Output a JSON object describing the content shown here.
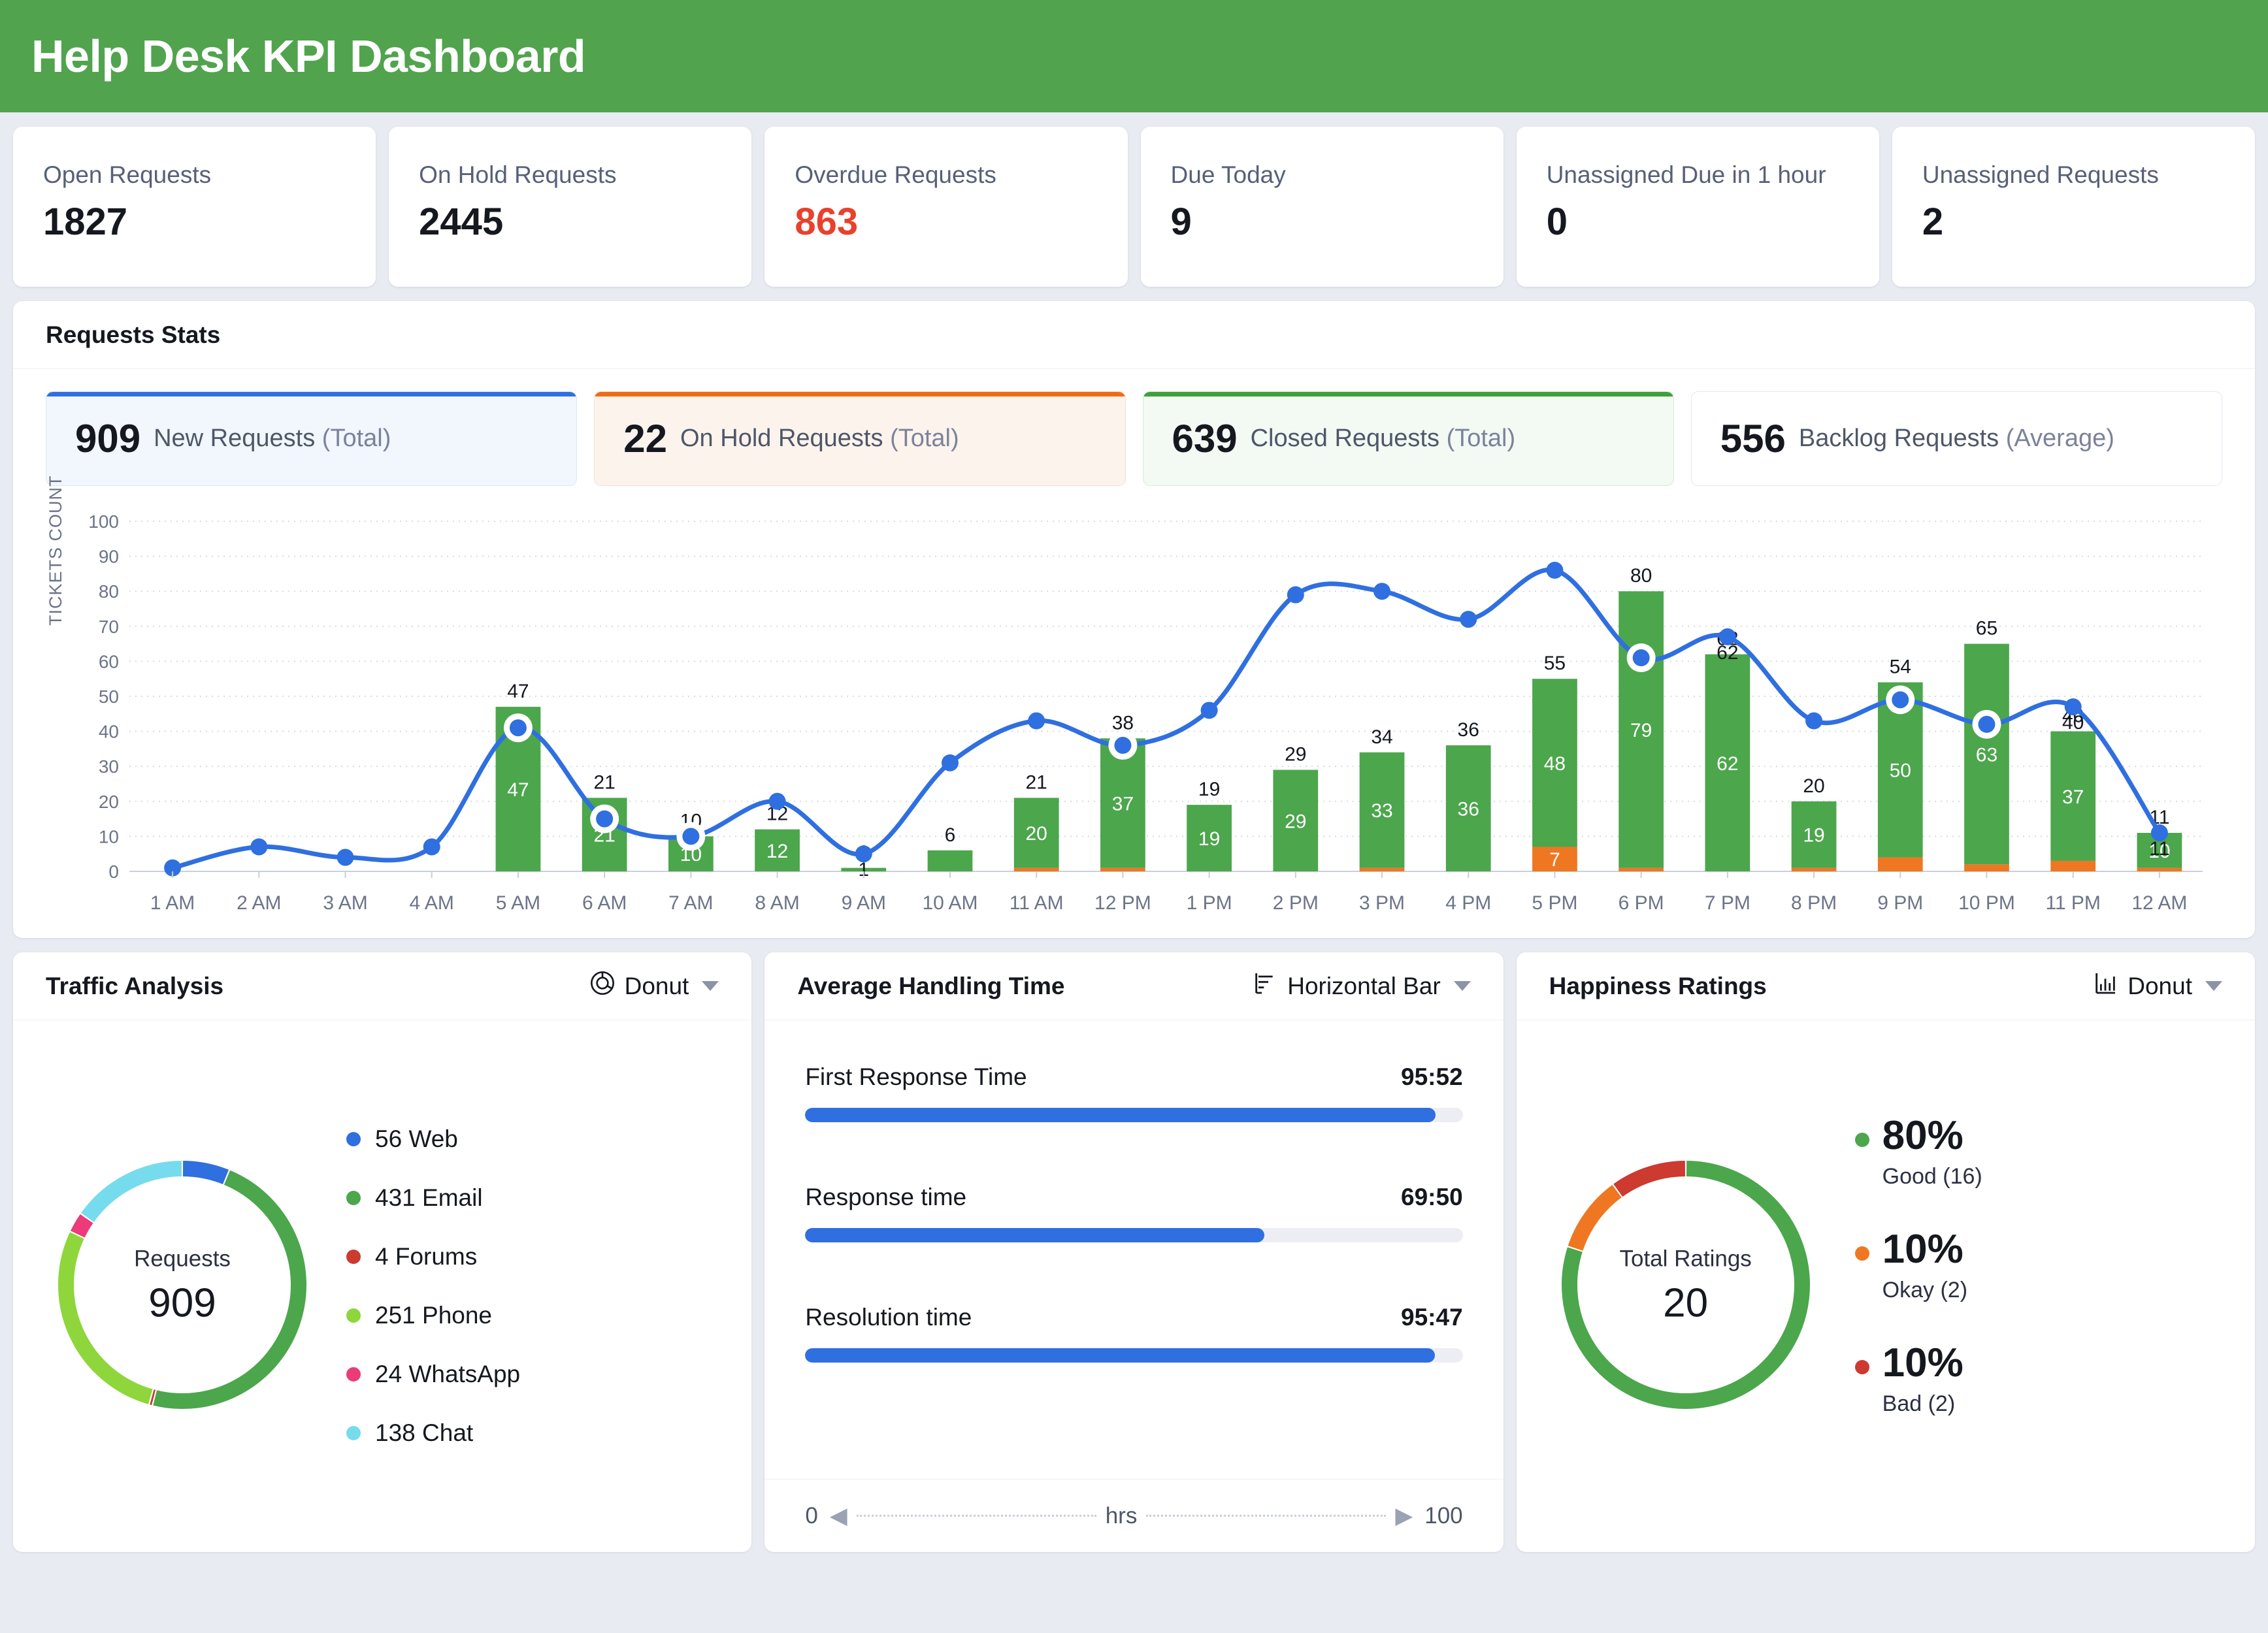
{
  "header": {
    "title": "Help Desk KPI Dashboard",
    "bg_color": "#51a34e"
  },
  "kpis": [
    {
      "label": "Open Requests",
      "value": "1827",
      "danger": false
    },
    {
      "label": "On Hold Requests",
      "value": "2445",
      "danger": false
    },
    {
      "label": "Overdue Requests",
      "value": "863",
      "danger": true
    },
    {
      "label": "Due Today",
      "value": "9",
      "danger": false
    },
    {
      "label": "Unassigned Due in 1 hour",
      "value": "0",
      "danger": false
    },
    {
      "label": "Unassigned Requests",
      "value": "2",
      "danger": false
    }
  ],
  "requests_stats": {
    "title": "Requests Stats",
    "pills": [
      {
        "value": "909",
        "label": "New Requests",
        "qualifier": "(Total)",
        "accent": "#2f6fe0"
      },
      {
        "value": "22",
        "label": "On Hold Requests",
        "qualifier": "(Total)",
        "accent": "#ef6c14"
      },
      {
        "value": "639",
        "label": "Closed Requests",
        "qualifier": "(Total)",
        "accent": "#3ea03a"
      },
      {
        "value": "556",
        "label": "Backlog Requests",
        "qualifier": "(Average)",
        "accent": "#ffffff"
      }
    ]
  },
  "chart_data": {
    "type": "bar",
    "title": "Requests Stats",
    "xlabel": "",
    "ylabel": "TICKETS COUNT",
    "ylim": [
      0,
      100
    ],
    "yticks": [
      0,
      10,
      20,
      30,
      40,
      50,
      60,
      70,
      80,
      90,
      100
    ],
    "grid": true,
    "legend": "none",
    "categories": [
      "1 AM",
      "2 AM",
      "3 AM",
      "4 AM",
      "5 AM",
      "6 AM",
      "7 AM",
      "8 AM",
      "9 AM",
      "10 AM",
      "11 AM",
      "12 PM",
      "1 PM",
      "2 PM",
      "3 PM",
      "4 PM",
      "5 PM",
      "6 PM",
      "7 PM",
      "8 PM",
      "9 PM",
      "10 PM",
      "11 PM",
      "12 AM"
    ],
    "series": [
      {
        "name": "Closed Requests",
        "type": "bar",
        "color": "#4ca64c",
        "values": [
          0,
          0,
          0,
          0,
          47,
          21,
          10,
          12,
          1,
          6,
          20,
          37,
          19,
          29,
          33,
          36,
          48,
          79,
          62,
          19,
          50,
          63,
          37,
          10
        ]
      },
      {
        "name": "On Hold Requests",
        "type": "bar",
        "color": "#ef7722",
        "values": [
          0,
          0,
          0,
          0,
          0,
          0,
          0,
          0,
          0,
          0,
          1,
          1,
          0,
          0,
          1,
          0,
          7,
          1,
          0,
          1,
          4,
          2,
          3,
          1
        ]
      },
      {
        "name": "New Requests",
        "type": "line",
        "color": "#2f6fe0",
        "values": [
          1,
          7,
          4,
          7,
          41,
          15,
          10,
          20,
          5,
          31,
          43,
          36,
          46,
          79,
          80,
          72,
          86,
          61,
          67,
          43,
          49,
          42,
          47,
          11
        ]
      }
    ],
    "bar_total_labels": [
      null,
      null,
      null,
      null,
      47,
      21,
      10,
      12,
      1,
      6,
      21,
      38,
      19,
      29,
      34,
      36,
      55,
      80,
      62,
      20,
      54,
      65,
      40,
      11
    ],
    "bar_inner_labels": [
      null,
      null,
      null,
      null,
      47,
      21,
      10,
      12,
      null,
      null,
      20,
      37,
      19,
      29,
      33,
      36,
      48,
      79,
      62,
      19,
      50,
      63,
      37,
      10
    ],
    "orange_inner_labels": [
      null,
      null,
      null,
      null,
      null,
      null,
      null,
      null,
      null,
      null,
      null,
      null,
      null,
      null,
      null,
      null,
      7,
      null,
      null,
      null,
      null,
      null,
      null,
      null
    ],
    "line_point_labels": [
      null,
      null,
      null,
      null,
      null,
      null,
      null,
      null,
      1,
      null,
      null,
      null,
      null,
      null,
      null,
      null,
      null,
      null,
      62,
      null,
      null,
      null,
      40,
      11
    ],
    "highlighted_points": [
      "5 AM",
      "6 AM",
      "7 AM",
      "12 PM",
      "6 PM",
      "9 PM",
      "10 PM"
    ]
  },
  "traffic": {
    "title": "Traffic Analysis",
    "select_label": "Donut",
    "select_icon": "donut-icon",
    "center_label": "Requests",
    "center_value": "909",
    "chart_data": {
      "type": "pie",
      "title": "Traffic Analysis",
      "total": 909,
      "labels": [
        "Web",
        "Email",
        "Forums",
        "Phone",
        "WhatsApp",
        "Chat"
      ],
      "values": [
        56,
        431,
        4,
        251,
        24,
        138
      ],
      "colors": [
        "#2f6fe0",
        "#4ca64c",
        "#cc3a30",
        "#8ed63c",
        "#ec3b78",
        "#76dced"
      ],
      "legend": "right"
    },
    "legend": [
      {
        "value": "56",
        "label": "Web",
        "color": "#2f6fe0"
      },
      {
        "value": "431",
        "label": "Email",
        "color": "#4ca64c"
      },
      {
        "value": "4",
        "label": "Forums",
        "color": "#cc3a30"
      },
      {
        "value": "251",
        "label": "Phone",
        "color": "#8ed63c"
      },
      {
        "value": "24",
        "label": "WhatsApp",
        "color": "#ec3b78"
      },
      {
        "value": "138",
        "label": "Chat",
        "color": "#76dced"
      }
    ]
  },
  "handling": {
    "title": "Average Handling Time",
    "select_label": "Horizontal Bar",
    "select_icon": "horizontal-bar-icon",
    "chart_data": {
      "type": "bar",
      "title": "Average Handling Time",
      "orientation": "horizontal",
      "categories": [
        "First Response Time",
        "Response time",
        "Resolution time"
      ],
      "values": [
        95.52,
        69.5,
        95.47
      ],
      "value_labels": [
        "95:52",
        "69:50",
        "95:47"
      ],
      "xlim": [
        0,
        100
      ],
      "xlabel": "hrs",
      "bar_color": "#2f6fe0"
    },
    "rows": [
      {
        "label": "First Response Time",
        "value": "95:52",
        "pct": 95.87
      },
      {
        "label": "Response time",
        "value": "69:50",
        "pct": 69.83
      },
      {
        "label": "Resolution time",
        "value": "95:47",
        "pct": 95.78
      }
    ],
    "axis_min": "0",
    "axis_unit": "hrs",
    "axis_max": "100"
  },
  "happiness": {
    "title": "Happiness Ratings",
    "select_label": "Donut",
    "select_icon": "bar-chart-icon",
    "center_label": "Total Ratings",
    "center_value": "20",
    "chart_data": {
      "type": "pie",
      "title": "Happiness Ratings",
      "total": 20,
      "labels": [
        "Good",
        "Okay",
        "Bad"
      ],
      "values": [
        16,
        2,
        2
      ],
      "percents": [
        80,
        10,
        10
      ],
      "colors": [
        "#4ca64c",
        "#ef7722",
        "#cc3a30"
      ],
      "legend": "right"
    },
    "legend": [
      {
        "pct": "80%",
        "label": "Good (16)",
        "color": "#4ca64c"
      },
      {
        "pct": "10%",
        "label": "Okay (2)",
        "color": "#ef7722"
      },
      {
        "pct": "10%",
        "label": "Bad (2)",
        "color": "#cc3a30"
      }
    ]
  }
}
